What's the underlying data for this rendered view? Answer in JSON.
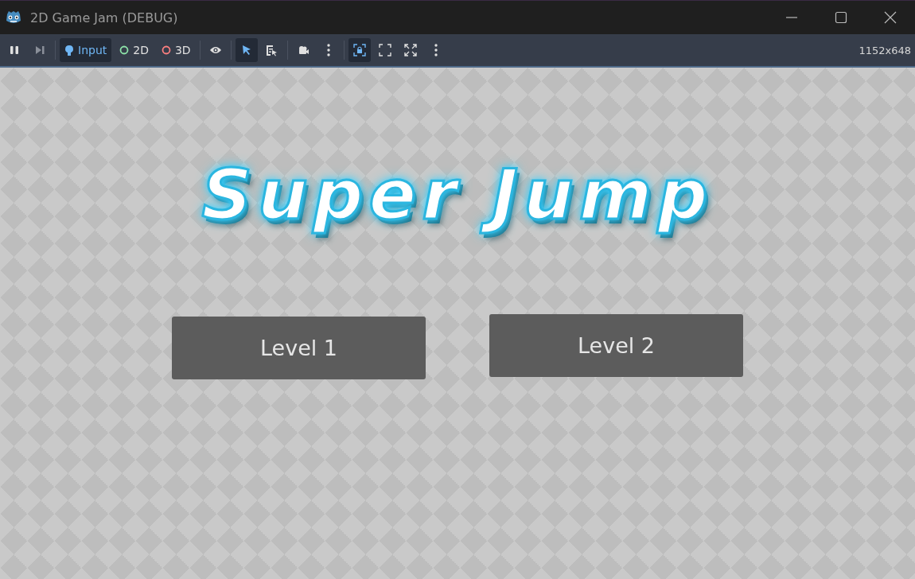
{
  "window": {
    "title": "2D Game Jam (DEBUG)"
  },
  "toolbar": {
    "groups": [
      [
        {
          "kind": "pause",
          "selected": false
        },
        {
          "kind": "step",
          "selected": false
        }
      ],
      [
        {
          "kind": "input",
          "label": "Input",
          "selected": true
        },
        {
          "kind": "ring2d",
          "label": "2D",
          "selected": false
        },
        {
          "kind": "ring3d",
          "label": "3D",
          "selected": false
        }
      ],
      [
        {
          "kind": "eye",
          "selected": false
        }
      ],
      [
        {
          "kind": "pointer",
          "selected": true
        },
        {
          "kind": "listpick",
          "selected": false
        }
      ],
      [
        {
          "kind": "camera",
          "selected": false
        },
        {
          "kind": "more",
          "selected": false
        }
      ],
      [
        {
          "kind": "lock",
          "selected": true
        },
        {
          "kind": "corners",
          "selected": false
        },
        {
          "kind": "expand",
          "selected": false
        },
        {
          "kind": "more",
          "selected": false
        }
      ]
    ],
    "resolution": "1152x648"
  },
  "game": {
    "title": "Super Jump",
    "buttons": [
      {
        "label": "Level 1"
      },
      {
        "label": "Level 2"
      }
    ]
  }
}
